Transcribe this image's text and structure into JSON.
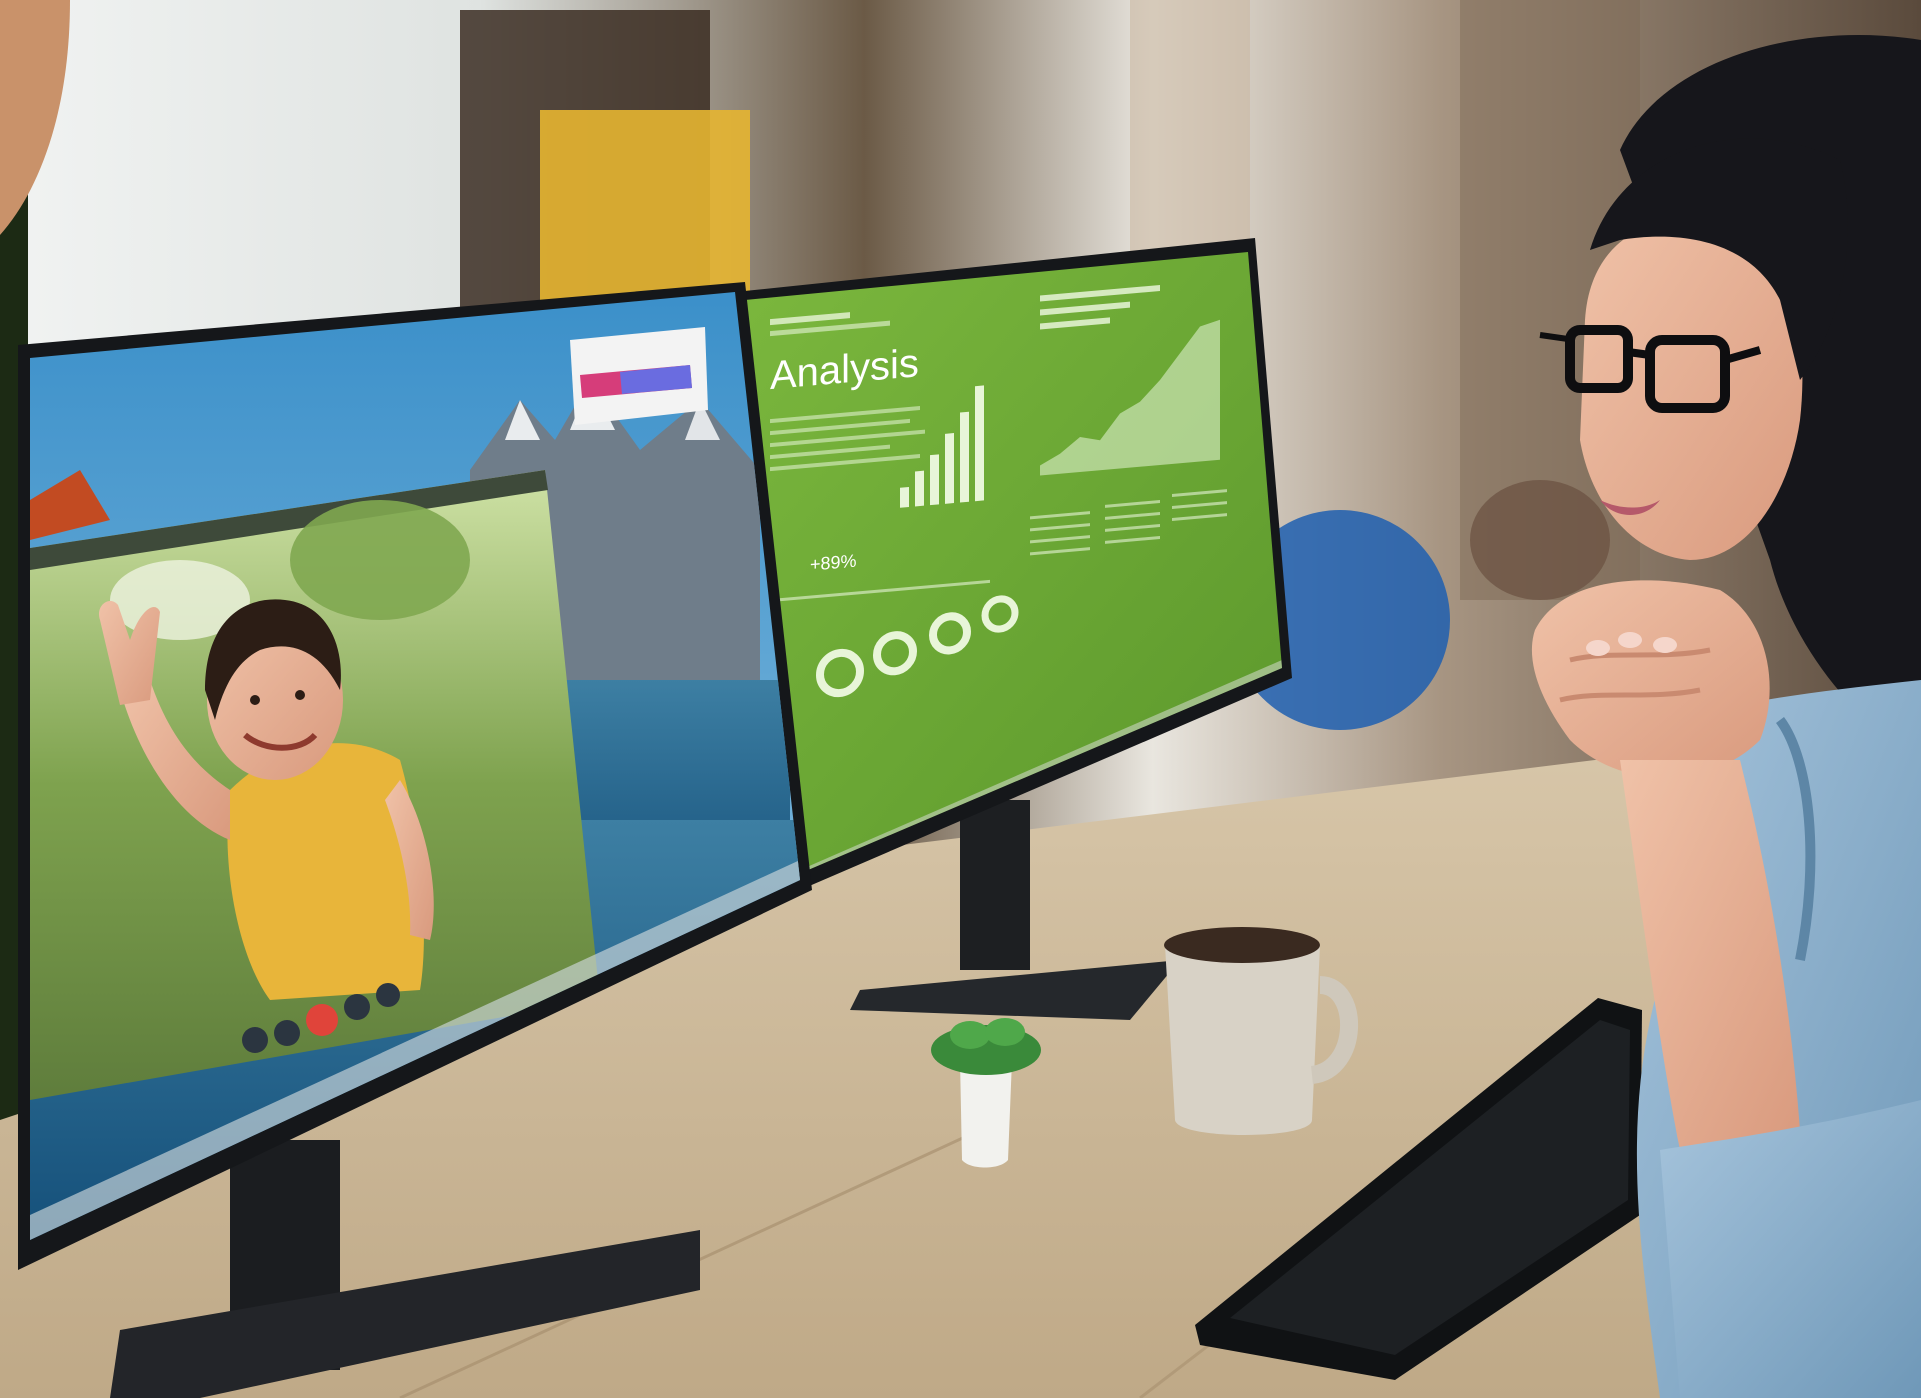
{
  "right_monitor": {
    "title": "Analysis",
    "stat_label": "+89%"
  },
  "colors": {
    "analysis_green": "#6aa532",
    "desk_wood": "#c9b597",
    "sweater_yellow": "#e8b53a",
    "shirt_denim": "#8fb3cf",
    "end_call_red": "#e0443a",
    "wall_white": "#e8ebe8",
    "copper_accent": "#c9926a",
    "plant_green": "#3a8a3a"
  },
  "icons": [
    "end-call-icon",
    "mute-icon",
    "video-icon",
    "more-icon"
  ]
}
